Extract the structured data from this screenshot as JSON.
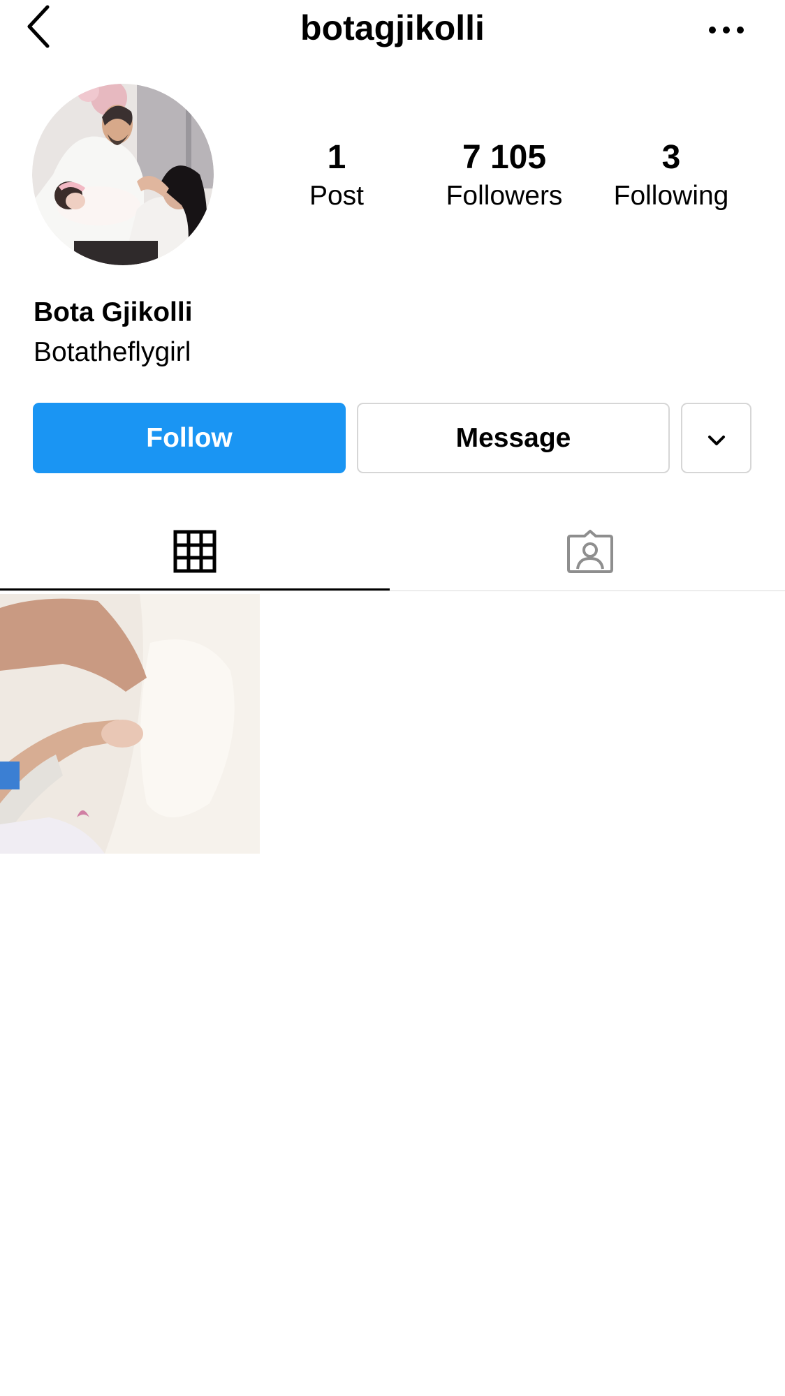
{
  "header": {
    "username": "botagjikolli",
    "back_icon": "chevron-left-icon",
    "more_icon": "ellipsis-icon"
  },
  "profile": {
    "avatar_icon": "profile-photo",
    "full_name": "Bota Gjikolli",
    "bio": "Botatheflygirl",
    "stats": {
      "posts": {
        "value": "1",
        "label": "Post"
      },
      "followers": {
        "value": "7 105",
        "label": "Followers"
      },
      "following": {
        "value": "3",
        "label": "Following"
      }
    }
  },
  "actions": {
    "follow_label": "Follow",
    "message_label": "Message",
    "suggestions_icon": "chevron-down-icon",
    "follow_color": "#1a95f3"
  },
  "tabs": [
    {
      "name": "posts",
      "icon": "grid-icon",
      "active": true
    },
    {
      "name": "tagged",
      "icon": "tagged-person-icon",
      "active": false
    }
  ],
  "posts": [
    {
      "icon": "photo-thumbnail"
    }
  ]
}
